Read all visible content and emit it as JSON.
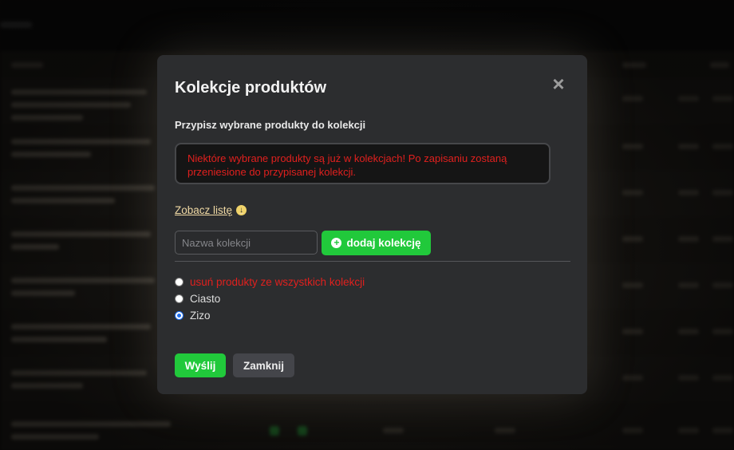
{
  "modal": {
    "title": "Kolekcje produktów",
    "close_icon": "×",
    "subtitle": "Przypisz wybrane produkty do kolekcji",
    "alert_text": "Niektóre wybrane produkty są już w kolekcjach! Po zapisaniu zostaną przeniesione do przypisanej kolekcji.",
    "see_list_label": "Zobacz listę",
    "see_list_icon": "arrow-down-circle-icon",
    "collection_input": {
      "placeholder": "Nazwa kolekcji",
      "value": ""
    },
    "add_button_label": "dodaj kolekcję",
    "add_button_icon": "plus-circle-icon",
    "options": [
      {
        "label": "usuń produkty ze wszystkich kolekcji",
        "checked": false,
        "color": "#e0201e"
      },
      {
        "label": "Ciasto",
        "checked": false
      },
      {
        "label": "Zizo",
        "checked": true
      }
    ],
    "send_label": "Wyślij",
    "close_label": "Zamknij"
  },
  "colors": {
    "accent_green": "#21c93b",
    "alert_red": "#e0201e",
    "link_yellow": "#f0d9a4",
    "modal_bg": "#2c2d2f"
  }
}
